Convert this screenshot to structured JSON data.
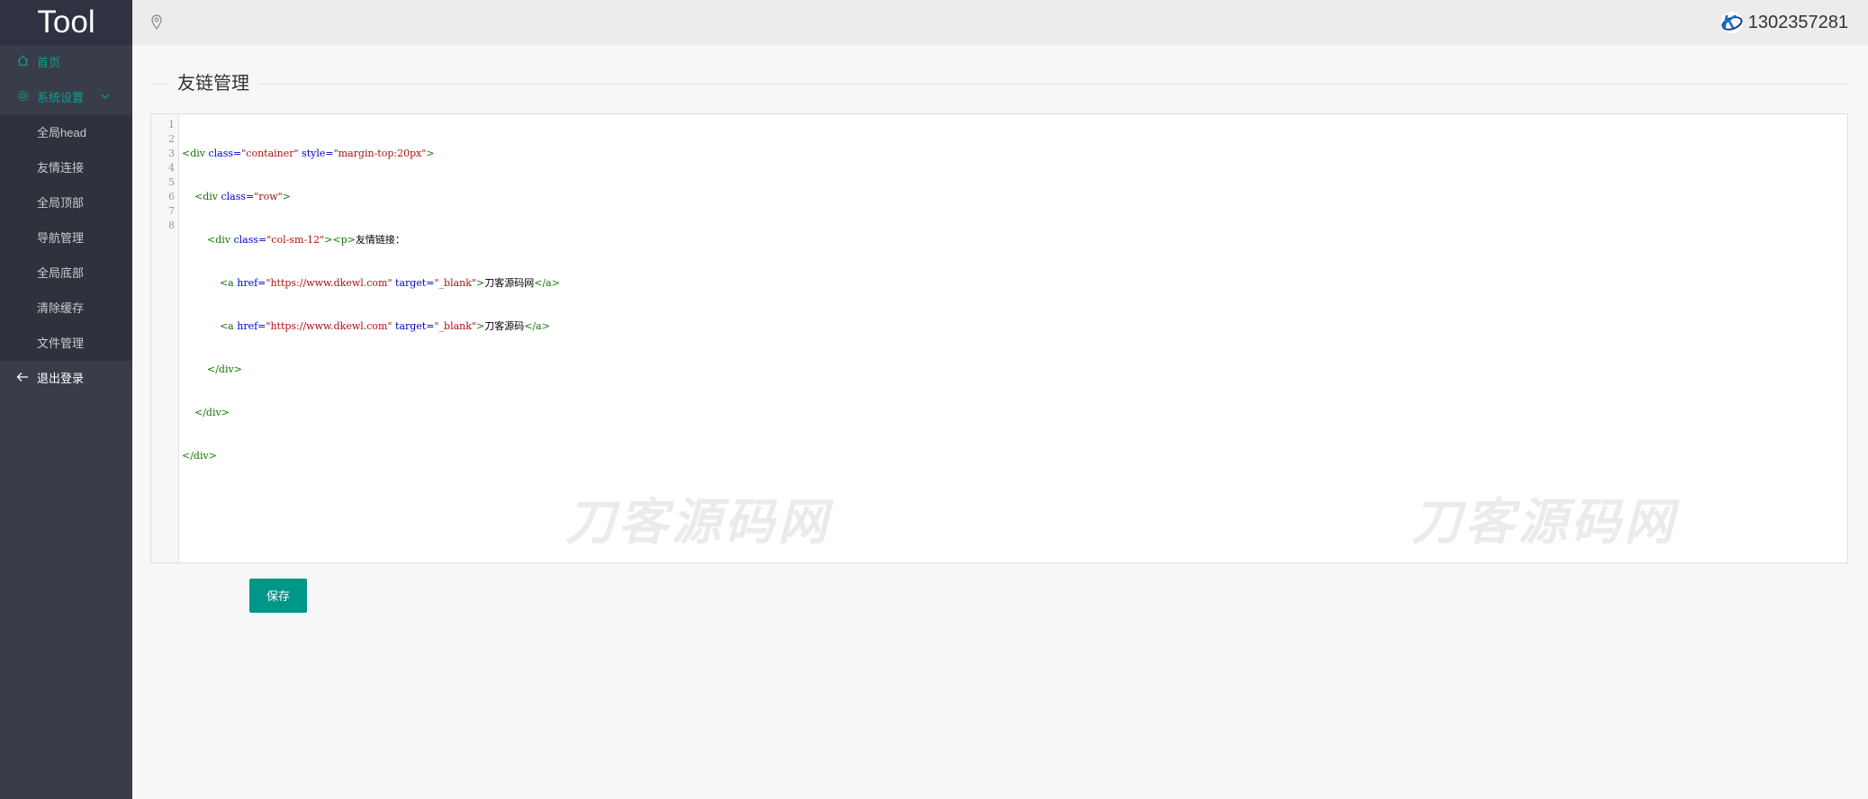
{
  "app": {
    "logo": "Tool"
  },
  "sidebar": {
    "items": [
      {
        "label": "首页",
        "icon": "home-icon"
      },
      {
        "label": "系统设置",
        "icon": "gear-icon"
      }
    ],
    "sub_items": [
      {
        "label": "全局head"
      },
      {
        "label": "友情连接"
      },
      {
        "label": "全局顶部"
      },
      {
        "label": "导航管理"
      },
      {
        "label": "全局底部"
      },
      {
        "label": "清除缓存"
      },
      {
        "label": "文件管理"
      }
    ],
    "logout": {
      "label": "退出登录",
      "icon": "arrow-left-icon"
    }
  },
  "header": {
    "user": "1302357281",
    "location_icon": "map-pin-icon"
  },
  "page": {
    "title": "友链管理"
  },
  "editor": {
    "line_numbers": [
      "1",
      "2",
      "3",
      "4",
      "5",
      "6",
      "7",
      "8"
    ],
    "lines": [
      "<div class=\"container\" style=\"margin-top:20px\">",
      "    <div class=\"row\">",
      "        <div class=\"col-sm-12\"><p>友情链接：",
      "            <a href=\"https://www.dkewl.com\" target=\"_blank\">刀客源码网</a>",
      "            <a href=\"https://www.dkewl.com\" target=\"_blank\">刀客源码</a>",
      "        </div>",
      "    </div>",
      "</div>"
    ]
  },
  "watermark": "刀客源码网",
  "actions": {
    "save_label": "保存"
  },
  "colors": {
    "accent": "#009688",
    "sidebar_bg": "#393d49",
    "active_text": "#0f9e8e"
  }
}
